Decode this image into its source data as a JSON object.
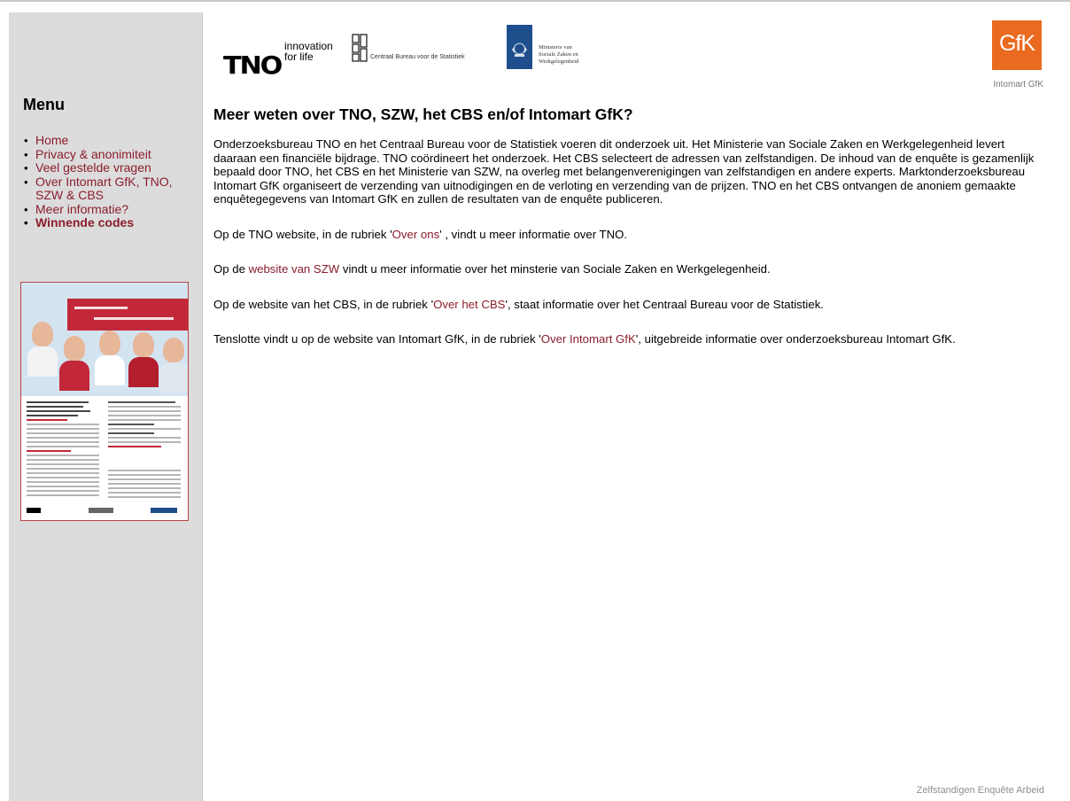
{
  "logos": {
    "tno_word": "TNO",
    "tno_tag1": "innovation",
    "tno_tag2": "for life",
    "cbs_text": "Centraal Bureau voor de Statistiek",
    "szw_line1": "Ministerie van Sociale Zaken en",
    "szw_line2": "Werkgelegenheid",
    "gfk_logo": "GfK",
    "gfk_caption": "Intomart GfK"
  },
  "menu": {
    "title": "Menu",
    "items": [
      {
        "label": "Home"
      },
      {
        "label": "Privacy & anonimiteit"
      },
      {
        "label": "Veel gestelde vragen"
      },
      {
        "label": "Over Intomart GfK, TNO, SZW & CBS"
      },
      {
        "label": "Meer informatie?"
      },
      {
        "label": "Winnende codes"
      }
    ]
  },
  "main": {
    "heading": "Meer weten over TNO, SZW, het CBS en/of Intomart GfK?",
    "intro": "Onderzoeksbureau TNO en het Centraal Bureau voor de Statistiek voeren dit onderzoek uit. Het Ministerie van Sociale Zaken en Werkgelegenheid levert daaraan een financiële bijdrage. TNO coördineert het onderzoek. Het CBS selecteert de adressen van zelfstandigen. De inhoud van de enquête is gezamenlijk bepaald door TNO, het CBS en het Ministerie van SZW, na overleg met belangenverenigingen van zelfstandigen en andere experts. Marktonderzoeksbureau Intomart GfK organiseert de verzending van uitnodigingen en de verloting en verzending van de prijzen. TNO en het CBS ontvangen de anoniem gemaakte enquêtegegevens van Intomart GfK en zullen de resultaten van de enquête publiceren.",
    "p2_pre": "Op de TNO website, in de rubriek '",
    "p2_link": "Over ons",
    "p2_post": "' , vindt u meer informatie over TNO.",
    "p3_pre": "Op de ",
    "p3_link": "website van SZW",
    "p3_post": " vindt u meer informatie over het minsterie van Sociale Zaken en Werkgelegenheid.",
    "p4_pre": "Op de website van het CBS, in de rubriek '",
    "p4_link": "Over het CBS",
    "p4_post": "', staat informatie over het Centraal Bureau voor de Statistiek.",
    "p5_pre": "Tenslotte vindt u op de website van Intomart GfK, in de rubriek '",
    "p5_link": "Over Intomart GfK",
    "p5_post": "', uitgebreide informatie over onderzoeksbureau Intomart GfK."
  },
  "footer": "Zelfstandigen Enquête Arbeid",
  "colors": {
    "link": "#8b1d2c",
    "sidebar": "#dcdcdc",
    "gfk": "#ea6a1f",
    "szw": "#1f4e8c"
  }
}
